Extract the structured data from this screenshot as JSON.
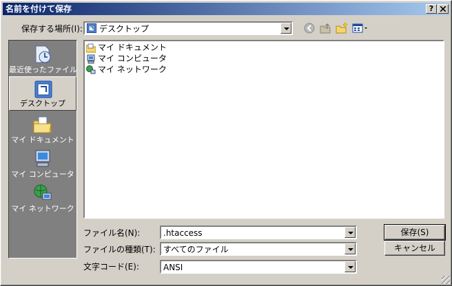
{
  "window": {
    "title": "名前を付けて保存",
    "help_label": "?",
    "close_label": "X"
  },
  "location": {
    "label": "保存する場所(I):",
    "value": "デスクトップ"
  },
  "places": [
    {
      "label": "最近使ったファイル",
      "icon": "recent-documents-icon"
    },
    {
      "label": "デスクトップ",
      "icon": "desktop-icon",
      "selected": true
    },
    {
      "label": "マイ ドキュメント",
      "icon": "my-documents-icon"
    },
    {
      "label": "マイ コンピュータ",
      "icon": "my-computer-icon"
    },
    {
      "label": "マイ ネットワーク",
      "icon": "my-network-icon"
    }
  ],
  "files": [
    {
      "name": "マイ ドキュメント",
      "icon": "folder-icon"
    },
    {
      "name": "マイ コンピュータ",
      "icon": "computer-icon"
    },
    {
      "name": "マイ ネットワーク",
      "icon": "network-icon"
    }
  ],
  "form": {
    "filename_label": "ファイル名(N):",
    "filename_value": ".htaccess",
    "filetype_label": "ファイルの種類(T):",
    "filetype_value": "すべてのファイル",
    "encoding_label": "文字コード(E):",
    "encoding_value": "ANSI"
  },
  "buttons": {
    "save": "保存(S)",
    "cancel": "キャンセル"
  },
  "colors": {
    "title_start": "#0a246a",
    "title_end": "#a6caf0",
    "face": "#d4d0c8",
    "places_bg": "#808080"
  }
}
